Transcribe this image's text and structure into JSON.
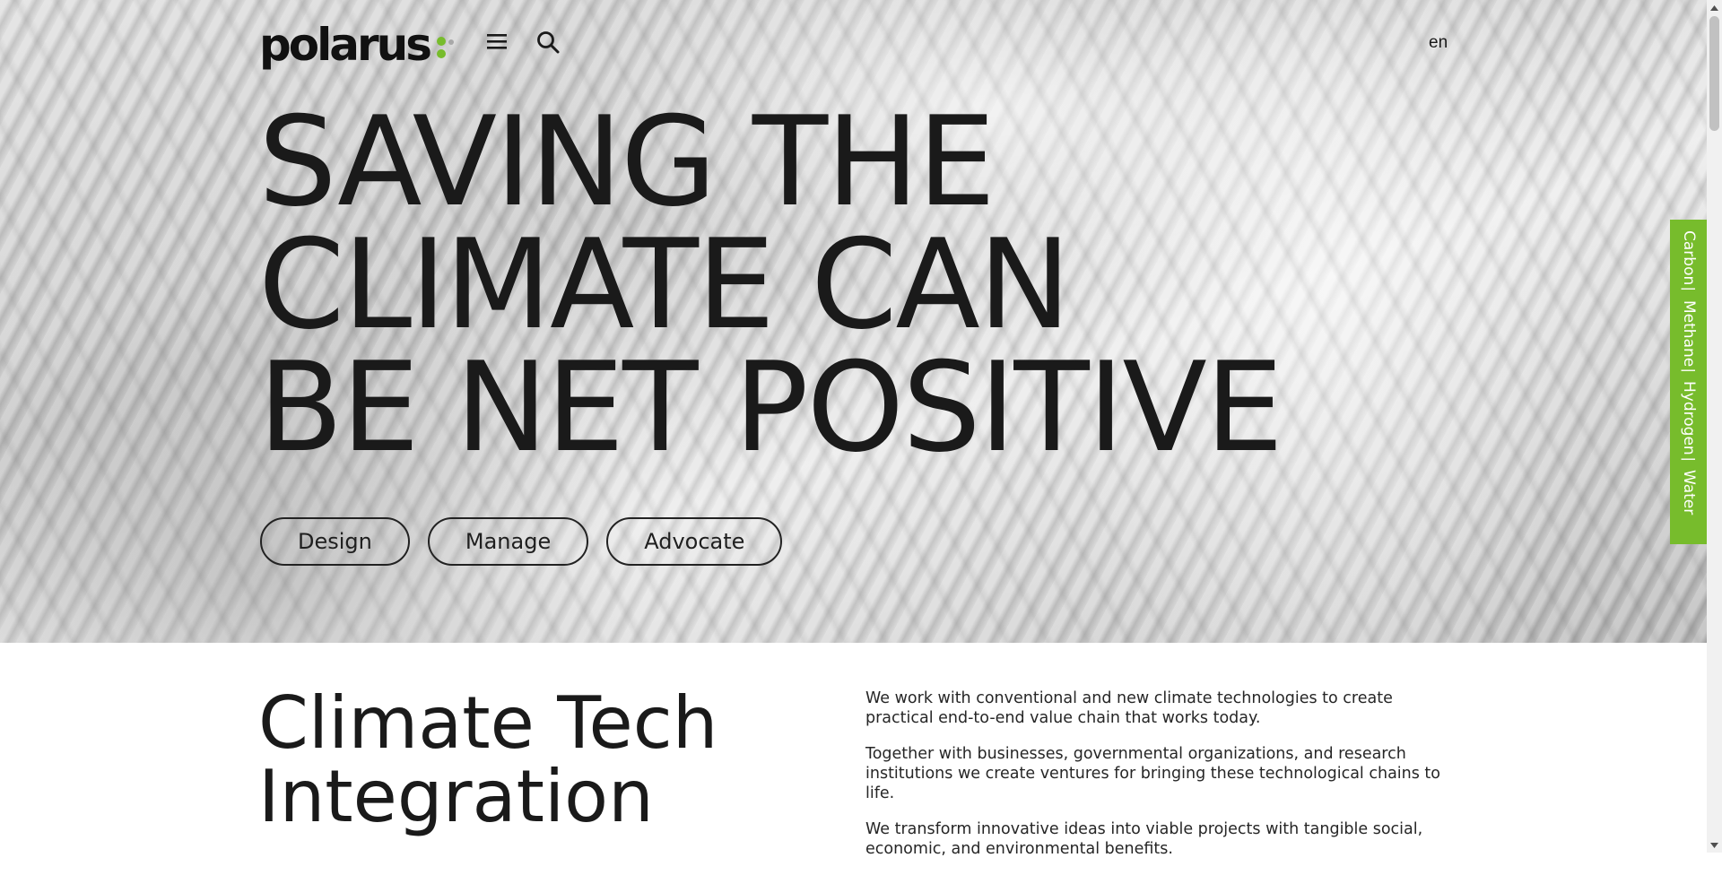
{
  "header": {
    "logo_text": "polarus",
    "logo_dot_colors": [
      "#77bc2c",
      "#77bc2c",
      "#a8a8a8"
    ],
    "menu_icon": "hamburger-menu-icon",
    "search_icon": "search-icon",
    "language": "en"
  },
  "hero": {
    "headline_lines": [
      "SAVING THE",
      "CLIMATE CAN",
      "BE NET POSITIVE"
    ],
    "pills": [
      "Design",
      "Manage",
      "Advocate"
    ]
  },
  "side_tab": {
    "color": "#77bc2c",
    "items": [
      "Carbon",
      "Methane",
      "Hydrogen",
      "Water"
    ],
    "separator": "|"
  },
  "intro": {
    "title_lines": [
      "Climate Tech",
      "Integration"
    ],
    "paragraphs": [
      "We work with conventional and new climate technologies to create practical end-to-end value chain that works today.",
      "Together with businesses, governmental organizations, and research institutions we create ventures for bringing these technological chains to life.",
      "We transform innovative ideas into viable projects with tangible social, economic, and environmental benefits."
    ]
  }
}
